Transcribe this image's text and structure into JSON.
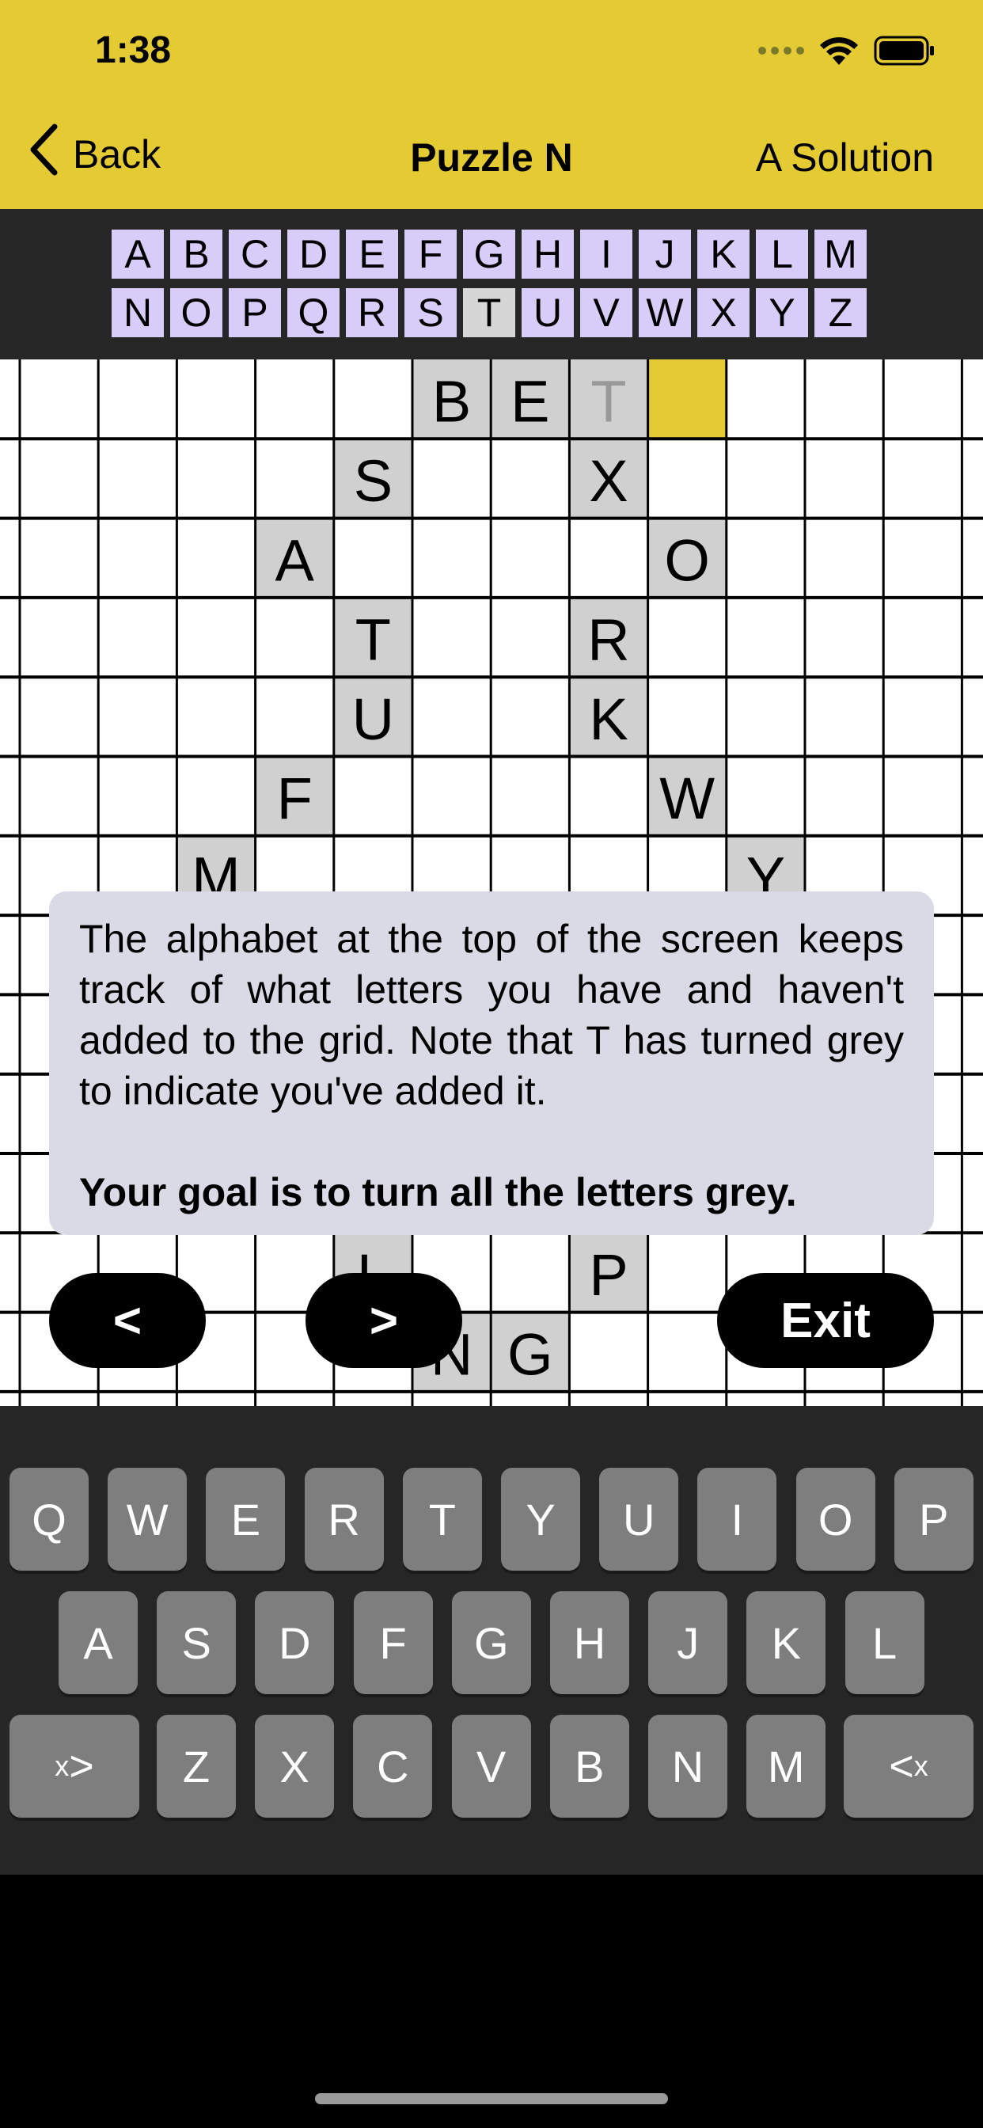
{
  "status_bar": {
    "time": "1:38"
  },
  "nav": {
    "back_label": "Back",
    "title": "Puzzle N",
    "solution_label": "A Solution"
  },
  "alphabet": {
    "row1": [
      "A",
      "B",
      "C",
      "D",
      "E",
      "F",
      "G",
      "H",
      "I",
      "J",
      "K",
      "L",
      "M"
    ],
    "row2": [
      "N",
      "O",
      "P",
      "Q",
      "R",
      "S",
      "T",
      "U",
      "V",
      "W",
      "X",
      "Y",
      "Z"
    ],
    "used": [
      "T"
    ]
  },
  "grid": {
    "highlight_color": "#E5CB33",
    "filled_color": "#D0D0D0",
    "cells": [
      {
        "row": 0,
        "col": 5,
        "letter": "B"
      },
      {
        "row": 0,
        "col": 6,
        "letter": "E"
      },
      {
        "row": 0,
        "col": 7,
        "letter": "T",
        "pending": true
      },
      {
        "row": 0,
        "col": 8,
        "letter": "",
        "highlight": true
      },
      {
        "row": 1,
        "col": 4,
        "letter": "S"
      },
      {
        "row": 1,
        "col": 7,
        "letter": "X"
      },
      {
        "row": 2,
        "col": 3,
        "letter": "A"
      },
      {
        "row": 2,
        "col": 8,
        "letter": "O"
      },
      {
        "row": 3,
        "col": 4,
        "letter": "T"
      },
      {
        "row": 3,
        "col": 7,
        "letter": "R"
      },
      {
        "row": 4,
        "col": 4,
        "letter": "U"
      },
      {
        "row": 4,
        "col": 7,
        "letter": "K"
      },
      {
        "row": 5,
        "col": 3,
        "letter": "F"
      },
      {
        "row": 5,
        "col": 8,
        "letter": "W"
      },
      {
        "row": 6,
        "col": 2,
        "letter": "M"
      },
      {
        "row": 6,
        "col": 9,
        "letter": "Y"
      },
      {
        "row": 11,
        "col": 4,
        "letter": "L"
      },
      {
        "row": 11,
        "col": 7,
        "letter": "P"
      },
      {
        "row": 12,
        "col": 5,
        "letter": "N"
      },
      {
        "row": 12,
        "col": 6,
        "letter": "G"
      }
    ]
  },
  "tooltip": {
    "body": "The alphabet at the top of the screen keeps track of what letters you have and haven't added to the grid. Note that T has turned grey to indicate you've added it.",
    "goal": "Your goal is to turn all the letters grey."
  },
  "buttons": {
    "prev_label": "<",
    "next_label": ">",
    "exit_label": "Exit"
  },
  "keyboard": {
    "row1": [
      "Q",
      "W",
      "E",
      "R",
      "T",
      "Y",
      "U",
      "I",
      "O",
      "P"
    ],
    "row2": [
      "A",
      "S",
      "D",
      "F",
      "G",
      "H",
      "J",
      "K",
      "L"
    ],
    "row3": [
      "Z",
      "X",
      "C",
      "V",
      "B",
      "N",
      "M"
    ],
    "left_special": {
      "small": "x",
      "big": ">"
    },
    "right_special": {
      "big": "<",
      "small": "x"
    }
  }
}
